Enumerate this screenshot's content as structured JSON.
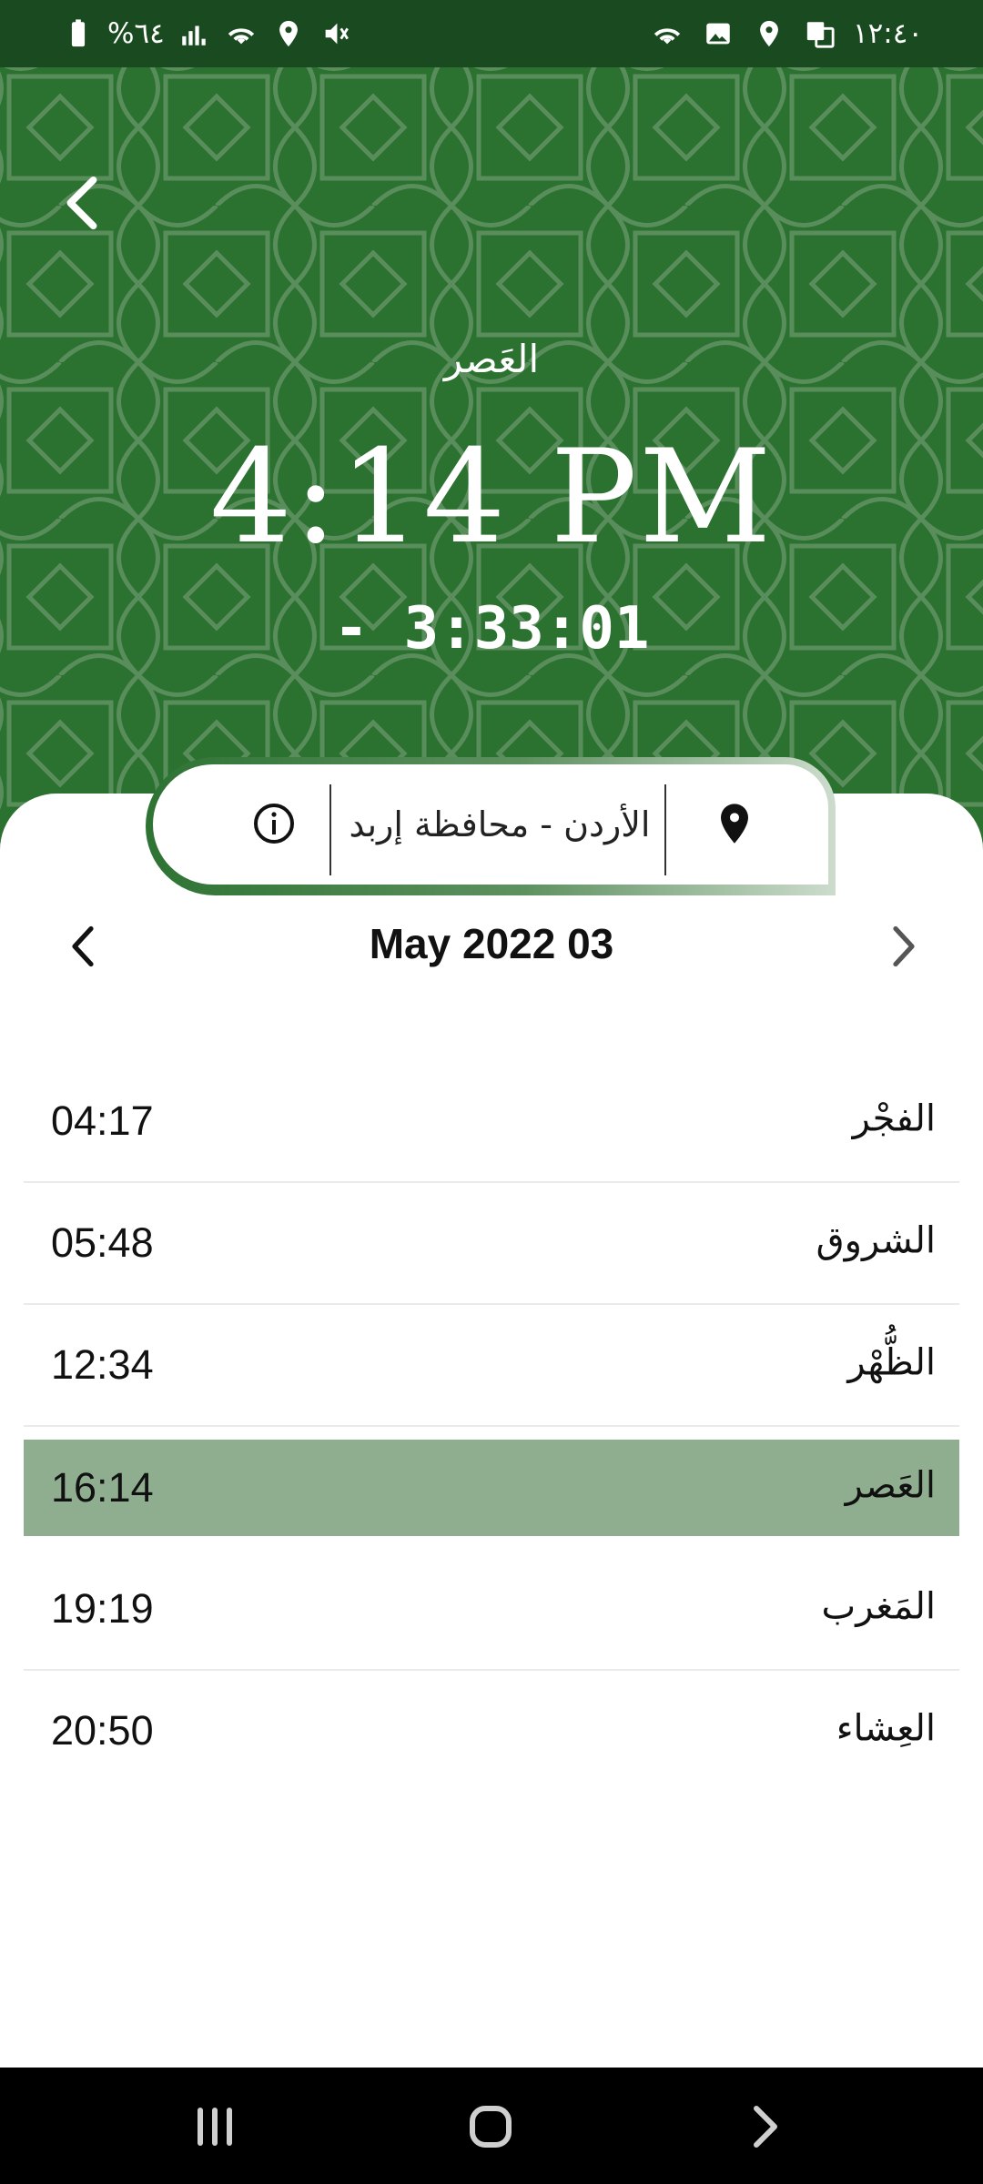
{
  "status_bar": {
    "time": "١٢:٤٠",
    "battery": "%٦٤",
    "icons_left": [
      "battery-charging-icon",
      "signal-icon",
      "wifi-icon",
      "location-icon",
      "mute-icon"
    ],
    "icons_right": [
      "wifi-icon",
      "gallery-icon",
      "location-icon",
      "translate-icon"
    ]
  },
  "header": {
    "prayer_name": "العَصر",
    "prayer_time": "4:14 PM",
    "countdown": "- 3:33:01",
    "back_icon": "back-arrow-icon"
  },
  "location": {
    "text": "الأردن - محافظة إربد",
    "info_icon": "info-icon",
    "pin_icon": "location-pin-icon"
  },
  "date_nav": {
    "date": "May 2022 03",
    "prev_icon": "chevron-left-icon",
    "next_icon": "chevron-right-icon"
  },
  "prayers": [
    {
      "name": "الفجْر",
      "time": "04:17",
      "active": false
    },
    {
      "name": "الشروق",
      "time": "05:48",
      "active": false
    },
    {
      "name": "الظُّهْر",
      "time": "12:34",
      "active": false
    },
    {
      "name": "العَصر",
      "time": "16:14",
      "active": true
    },
    {
      "name": "المَغرب",
      "time": "19:19",
      "active": false
    },
    {
      "name": "العِشاء",
      "time": "20:50",
      "active": false
    }
  ],
  "colors": {
    "header_green": "#2b7130",
    "status_green": "#1a4a1f",
    "active_row": "#8fae8f"
  },
  "nav_bar": {
    "icons": [
      "recent-apps-icon",
      "home-icon",
      "back-icon"
    ]
  }
}
